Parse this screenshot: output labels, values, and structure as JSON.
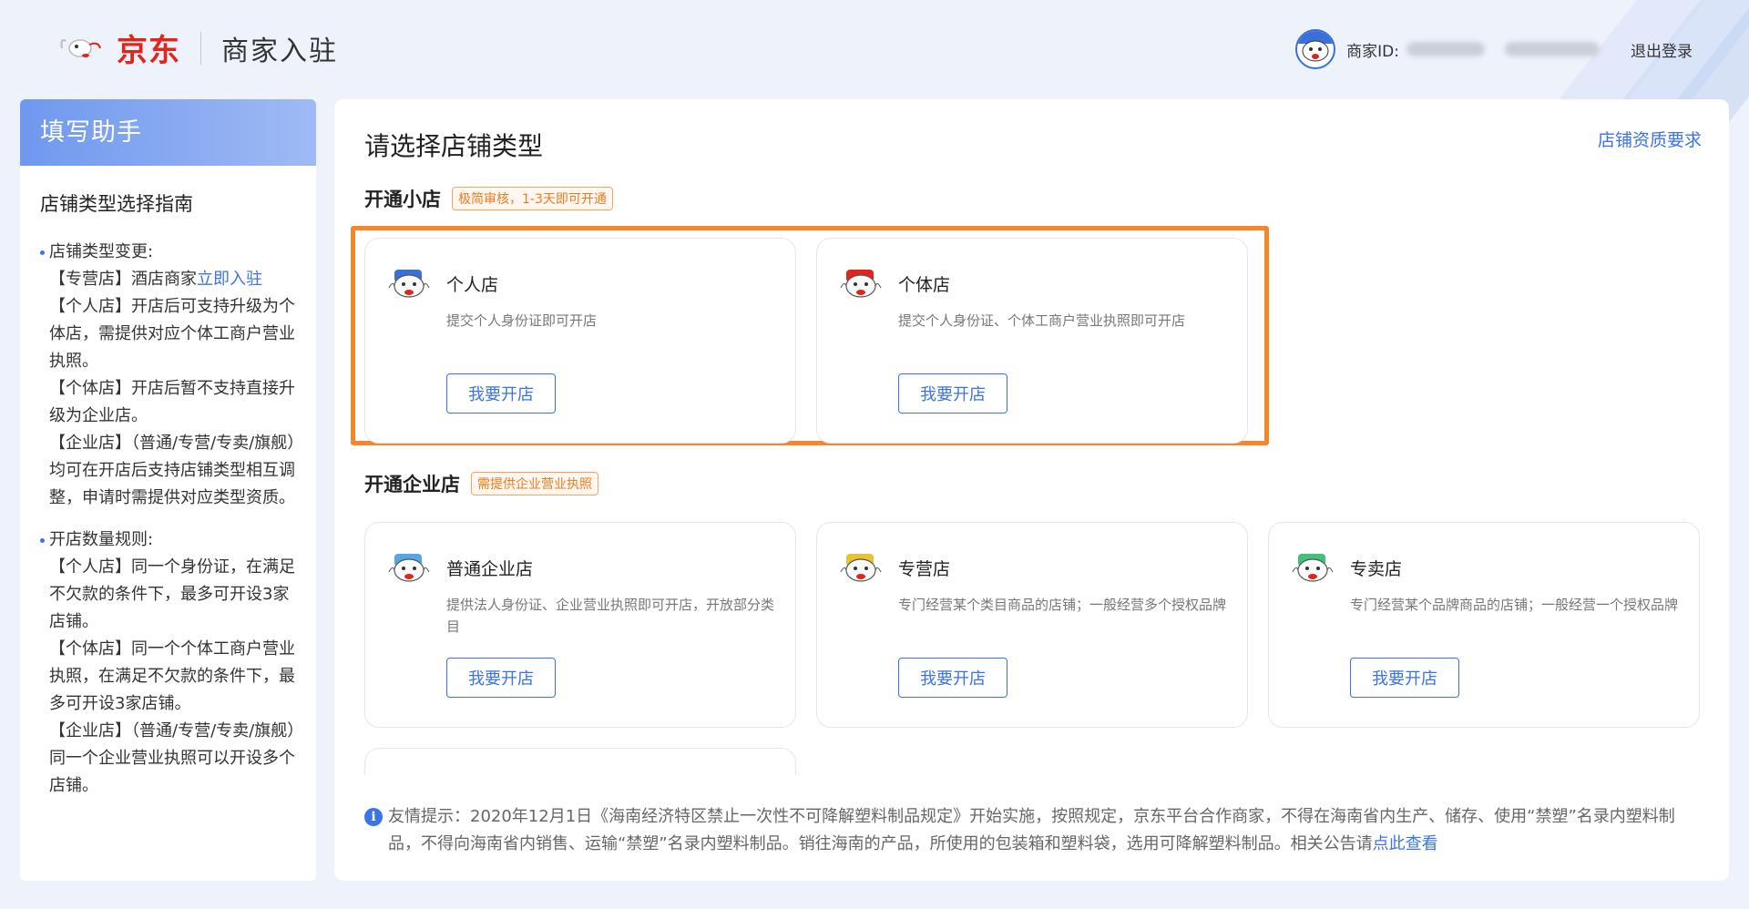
{
  "header": {
    "logo_text": "京东",
    "logo_sub": "商家入驻",
    "merchant_id_label": "商家ID:",
    "logout_label": "退出登录"
  },
  "sidebar": {
    "title": "填写助手",
    "guide_title": "店铺类型选择指南",
    "blocks": [
      {
        "head": "店铺类型变更:",
        "lines": [
          {
            "prefix": "【专营店】酒店商家",
            "link": "立即入驻"
          },
          {
            "text": "【个人店】开店后可支持升级为个体店，需提供对应个体工商户营业执照。"
          },
          {
            "text": "【个体店】开店后暂不支持直接升级为企业店。"
          },
          {
            "text": "【企业店】（普通/专营/专卖/旗舰）均可在开店后支持店铺类型相互调整，申请时需提供对应类型资质。"
          }
        ]
      },
      {
        "head": "开店数量规则:",
        "lines": [
          {
            "text": "【个人店】同一个身份证，在满足不欠款的条件下，最多可开设3家店铺。"
          },
          {
            "text": "【个体店】同一个个体工商户营业执照，在满足不欠款的条件下，最多可开设3家店铺。"
          },
          {
            "text": "【企业店】（普通/专营/专卖/旗舰）同一个企业营业执照可以开设多个店铺。"
          }
        ]
      }
    ]
  },
  "main": {
    "title": "请选择店铺类型",
    "requirements_link": "店铺资质要求",
    "small_section": {
      "label": "开通小店",
      "tag": "极简审核，1-3天即可开通"
    },
    "enterprise_section": {
      "label": "开通企业店",
      "tag": "需提供企业营业执照"
    },
    "cards": [
      {
        "name": "个人店",
        "desc": "提交个人身份证即可开店",
        "button": "我要开店",
        "icon": "jd-dog-blue-icon",
        "color": "#3b6fd8"
      },
      {
        "name": "个体店",
        "desc": "提交个人身份证、个体工商户营业执照即可开店",
        "button": "我要开店",
        "icon": "jd-dog-red-icon",
        "color": "#e1251b"
      },
      {
        "name": "普通企业店",
        "desc": "提供法人身份证、企业营业执照即可开店，开放部分类目",
        "button": "我要开店",
        "icon": "jd-dog-lightblue-icon",
        "color": "#57a7e8"
      },
      {
        "name": "专营店",
        "desc": "专门经营某个类目商品的店铺；一般经营多个授权品牌",
        "button": "我要开店",
        "icon": "jd-dog-yellow-icon",
        "color": "#e8c233"
      },
      {
        "name": "专卖店",
        "desc": "专门经营某个品牌商品的店铺；一般经营一个授权品牌",
        "button": "我要开店",
        "icon": "jd-dog-green-icon",
        "color": "#43c07a"
      }
    ],
    "notice": {
      "text": "友情提示：2020年12月1日《海南经济特区禁止一次性不可降解塑料制品规定》开始实施，按照规定，京东平台合作商家，不得在海南省内生产、储存、使用“禁塑”名录内塑料制品，不得向海南省内销售、运输“禁塑”名录内塑料制品。销往海南的产品，所使用的包装箱和塑料袋，选用可降解塑料制品。相关公告请",
      "link": "点此查看"
    }
  },
  "colors": {
    "accent": "#3b73e8",
    "highlight": "#f5862a",
    "tag_orange": "#f07a1d"
  }
}
